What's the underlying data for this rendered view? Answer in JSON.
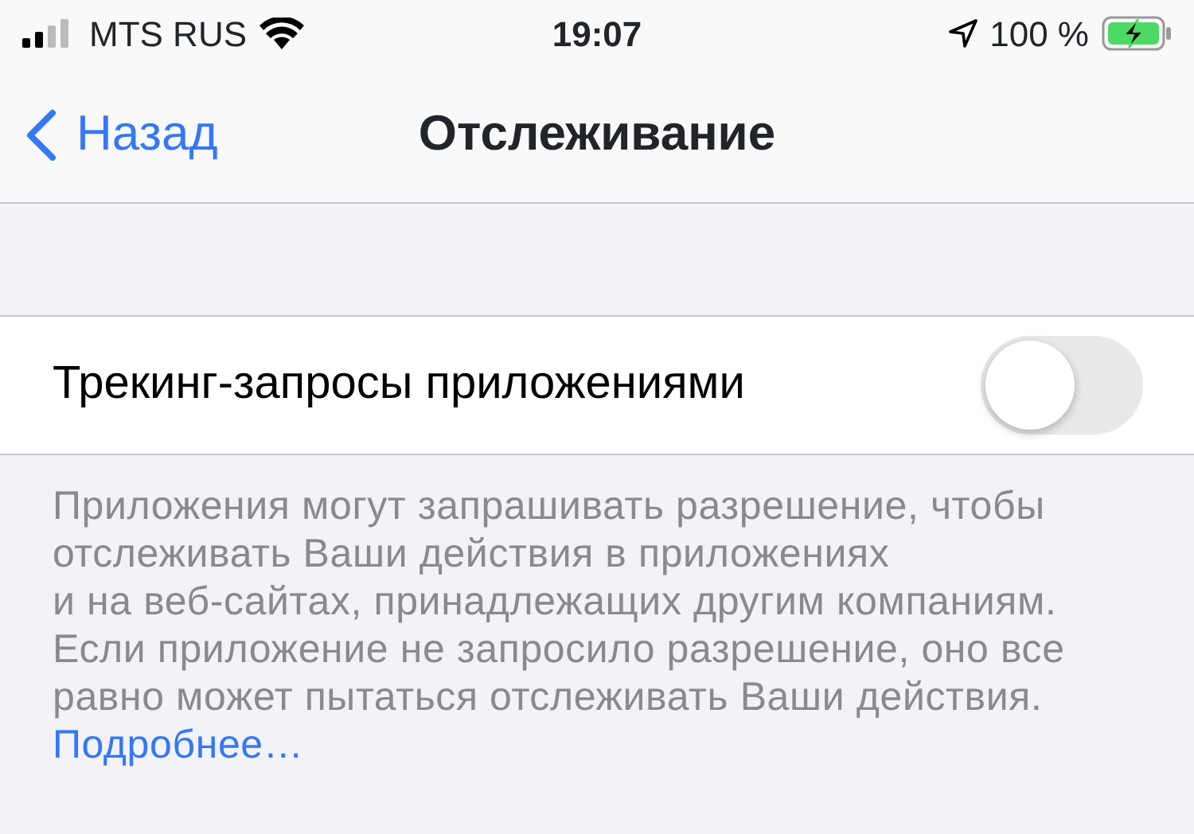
{
  "status_bar": {
    "carrier": "MTS RUS",
    "time": "19:07",
    "battery_text": "100 %",
    "charging": true
  },
  "nav_bar": {
    "back": "Назад",
    "title": "Отслеживание"
  },
  "settings": [
    {
      "label": "Трекинг-запросы приложениями",
      "on": false
    }
  ],
  "footer": {
    "lines": [
      "Приложения могут запрашивать разрешение, чтобы",
      "отслеживать Ваши действия в приложениях",
      "и на веб-сайтах, принадлежащих другим компаниям.",
      "Если приложение не запросило разрешение, оно все",
      "равно может пытаться отслеживать Ваши действия."
    ],
    "link": "Подробнее…"
  }
}
